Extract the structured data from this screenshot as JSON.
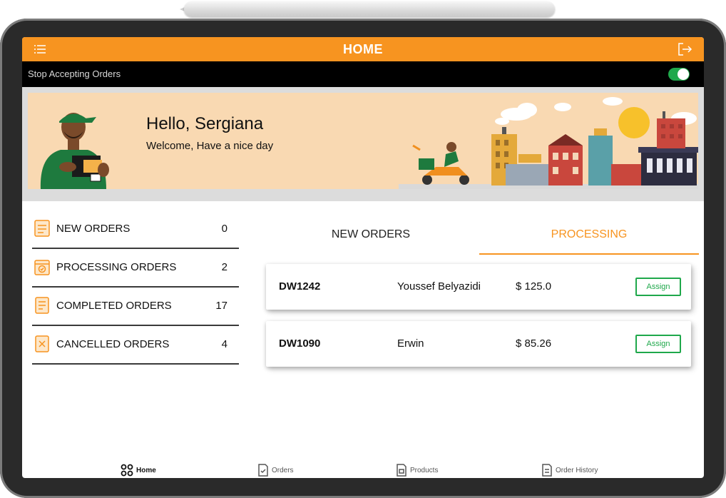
{
  "header": {
    "title": "HOME"
  },
  "toggle": {
    "label": "Stop Accepting Orders"
  },
  "banner": {
    "greeting": "Hello, Sergiana",
    "subtitle": "Welcome, Have a nice day"
  },
  "summary": [
    {
      "label": "NEW ORDERS",
      "count": "0",
      "icon": "new-orders-icon"
    },
    {
      "label": "PROCESSING ORDERS",
      "count": "2",
      "icon": "processing-orders-icon"
    },
    {
      "label": "COMPLETED ORDERS",
      "count": "17",
      "icon": "completed-orders-icon"
    },
    {
      "label": "CANCELLED ORDERS",
      "count": "4",
      "icon": "cancelled-orders-icon"
    }
  ],
  "tabs": {
    "new": "NEW ORDERS",
    "processing": "PROCESSING"
  },
  "orders": [
    {
      "id": "DW1242",
      "customer": "Youssef Belyazidi",
      "amount": "$ 125.0",
      "action": "Assign"
    },
    {
      "id": "DW1090",
      "customer": "Erwin",
      "amount": "$ 85.26",
      "action": "Assign"
    }
  ],
  "bottom_nav": [
    {
      "label": "Home",
      "icon": "home-grid-icon"
    },
    {
      "label": "Orders",
      "icon": "orders-icon"
    },
    {
      "label": "Products",
      "icon": "products-icon"
    },
    {
      "label": "Order History",
      "icon": "order-history-icon"
    }
  ],
  "colors": {
    "accent": "#f79420",
    "success": "#1fa84b",
    "banner": "#f9d9b2"
  }
}
